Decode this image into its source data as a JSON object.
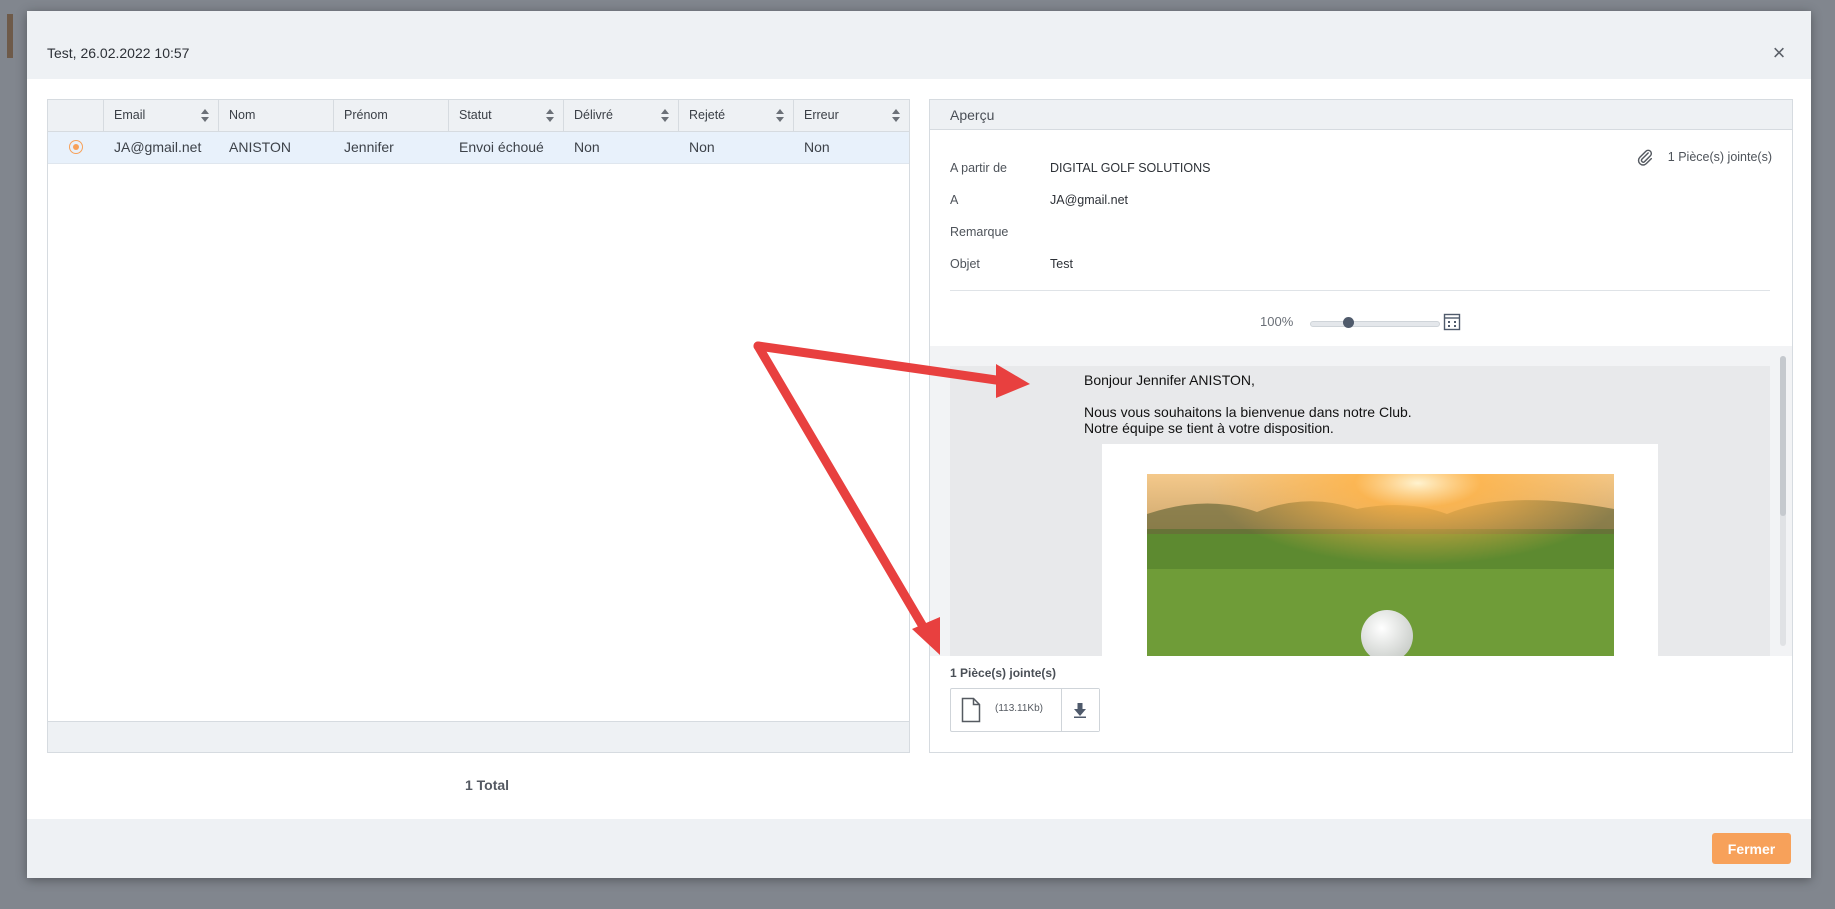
{
  "modal": {
    "title": "Test, 26.02.2022 10:57",
    "close_icon": "×",
    "footer_button": "Fermer"
  },
  "grid": {
    "columns": [
      "Email",
      "Nom",
      "Prénom",
      "Statut",
      "Délivré",
      "Rejeté",
      "Erreur"
    ],
    "rows": [
      {
        "email": "JA@gmail.net",
        "nom": "ANISTON",
        "prenom": "Jennifer",
        "statut": "Envoi échoué",
        "delivre": "Non",
        "rejete": "Non",
        "erreur": "Non",
        "selected": true
      }
    ],
    "total": "1 Total"
  },
  "preview": {
    "title": "Aperçu",
    "from_label": "A partir de",
    "from_value": "DIGITAL GOLF SOLUTIONS",
    "to_label": "A",
    "to_value": "JA@gmail.net",
    "remark_label": "Remarque",
    "remark_value": "",
    "subject_label": "Objet",
    "subject_value": "Test",
    "attachments_count": "1 Pièce(s) jointe(s)",
    "zoom": "100%",
    "zoom_level": 0.3,
    "email_body": {
      "greeting": "Bonjour Jennifer ANISTON,",
      "line1": "Nous vous souhaitons la bienvenue dans notre Club.",
      "line2": "Notre équipe se tient à votre disposition."
    },
    "attachments_label": "1 Pièce(s) jointe(s)",
    "attachment_size": "(113.11Kb)"
  },
  "colors": {
    "accent": "#f7a15a",
    "annotation_arrow": "#e8403f",
    "header_bg": "#eef1f4"
  }
}
